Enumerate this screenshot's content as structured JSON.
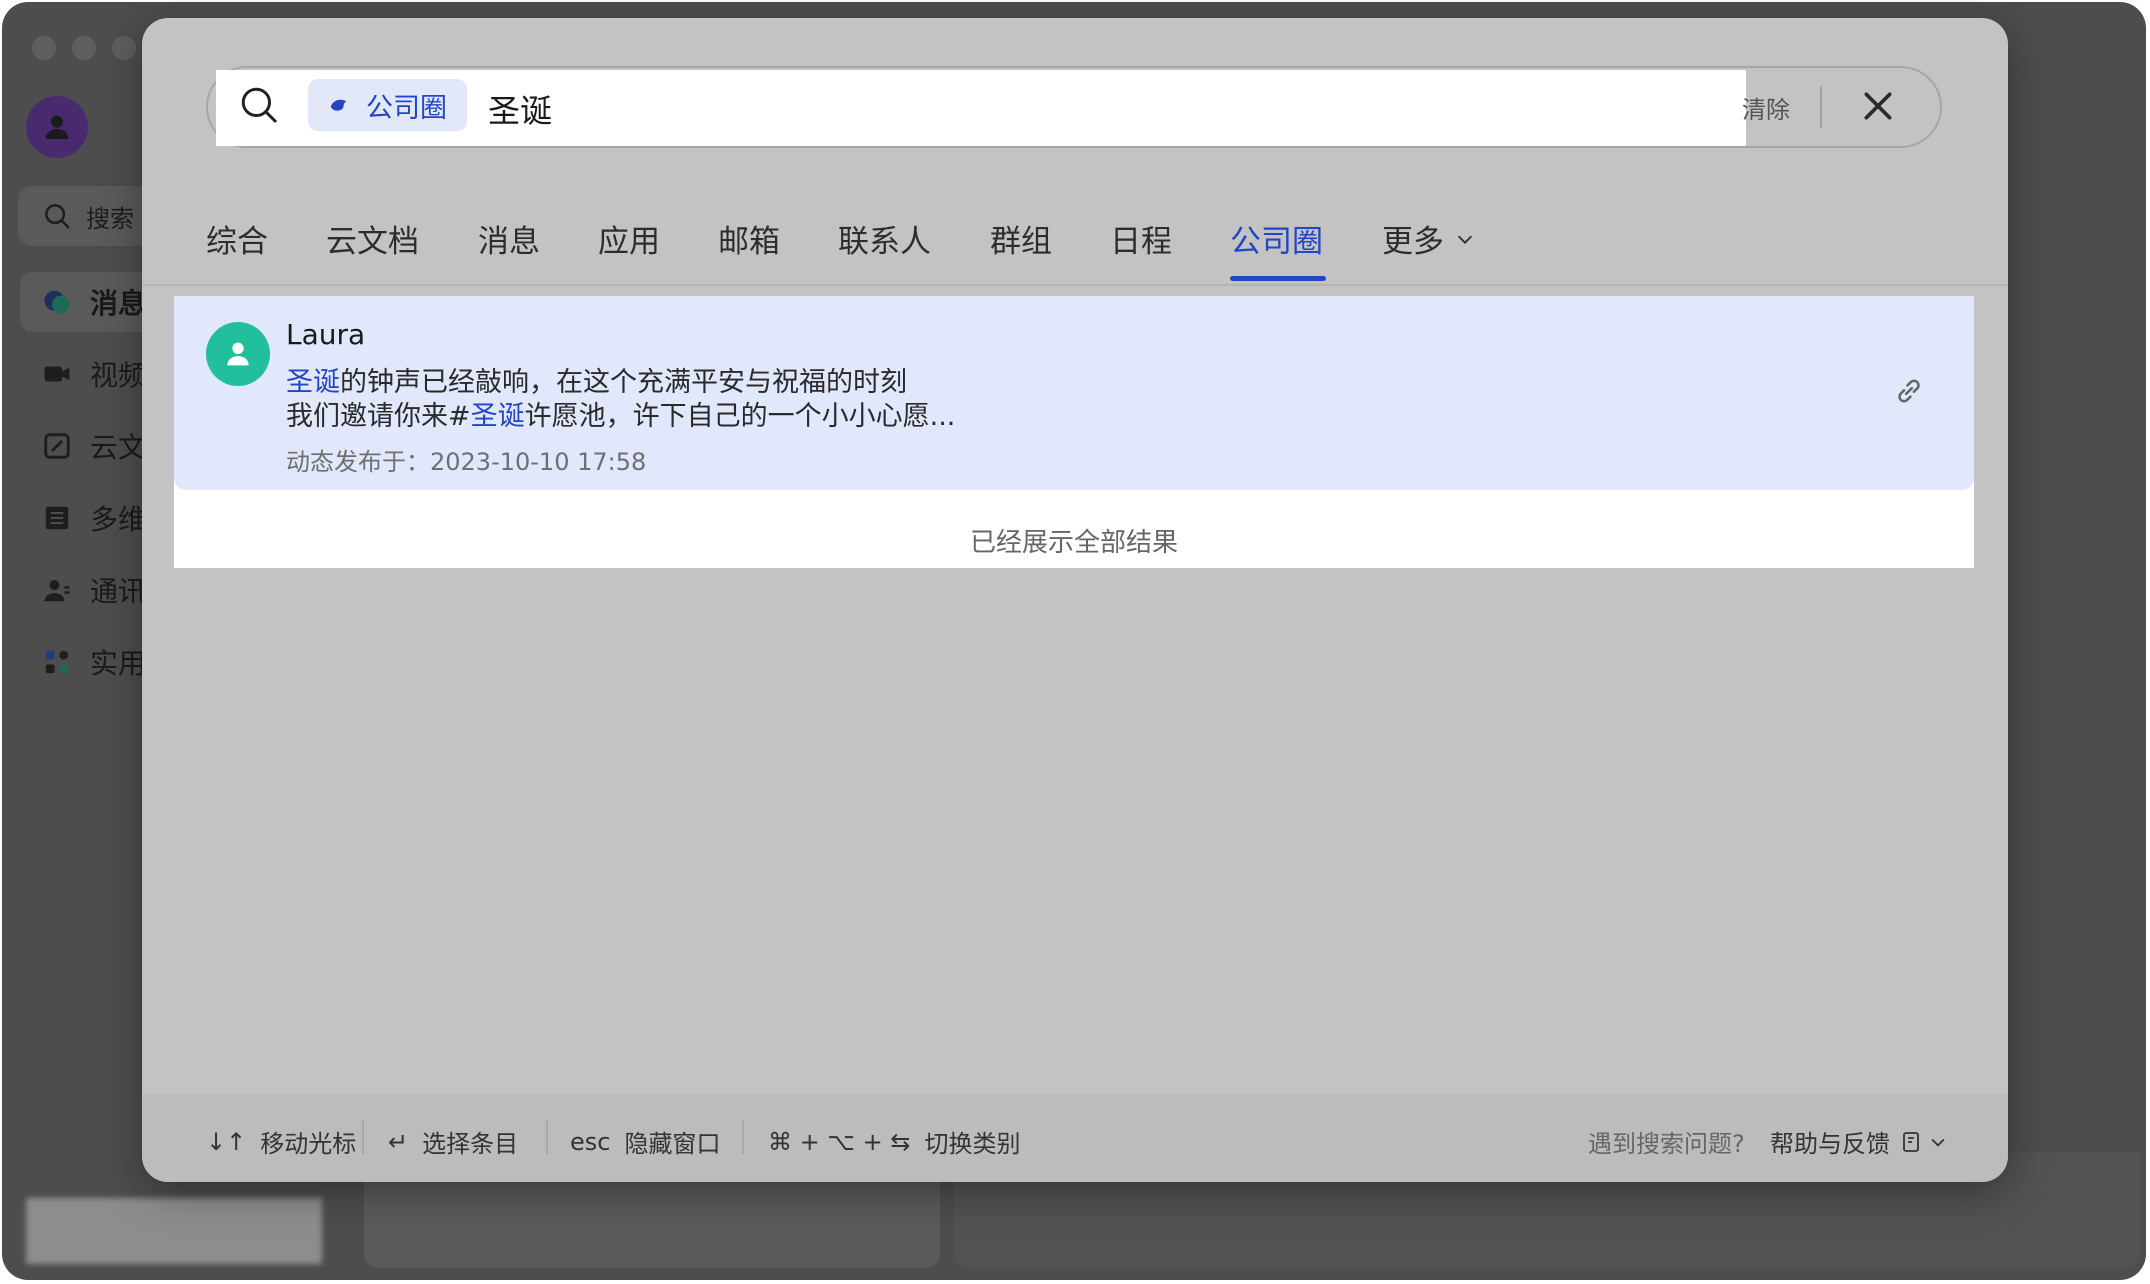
{
  "sidebar": {
    "search_label": "搜索",
    "items": [
      {
        "label": "消息",
        "icon": "chat-bubble-icon",
        "active": true
      },
      {
        "label": "视频",
        "icon": "video-camera-icon"
      },
      {
        "label": "云文",
        "icon": "cloud-doc-icon"
      },
      {
        "label": "多维",
        "icon": "table-icon"
      },
      {
        "label": "通讯",
        "icon": "contacts-icon"
      },
      {
        "label": "实用",
        "icon": "apps-icon"
      }
    ]
  },
  "search": {
    "scope_chip": "公司圈",
    "query": "圣诞",
    "clear_label": "清除"
  },
  "tabs": [
    {
      "label": "综合"
    },
    {
      "label": "云文档"
    },
    {
      "label": "消息"
    },
    {
      "label": "应用"
    },
    {
      "label": "邮箱"
    },
    {
      "label": "联系人"
    },
    {
      "label": "群组"
    },
    {
      "label": "日程"
    },
    {
      "label": "公司圈",
      "active": true
    },
    {
      "label": "更多"
    }
  ],
  "results": [
    {
      "author": "Laura",
      "line1_highlight": "圣诞",
      "line1_rest": "的钟声已经敲响，在这个充满平安与祝福的时刻",
      "line2_pre": "我们邀请你来#",
      "line2_highlight": "圣诞",
      "line2_rest": "许愿池，许下自己的一个小小心愿...",
      "meta": "动态发布于：2023-10-10 17:58"
    }
  ],
  "end_note": "已经展示全部结果",
  "footer": {
    "move": {
      "key": "↓↑",
      "label": "移动光标"
    },
    "select": {
      "key": "↵",
      "label": "选择条目"
    },
    "hide": {
      "key": "esc",
      "label": "隐藏窗口"
    },
    "switch": {
      "key": "⌘ + ⌥ + ⇆",
      "label": "切换类别"
    },
    "problem": "遇到搜索问题?",
    "help": "帮助与反馈"
  },
  "colors": {
    "accent": "#2346c7",
    "highlight_bg": "#e1e8fb",
    "avatar_green": "#22bf9d",
    "overlay": "#c3c3c3"
  }
}
